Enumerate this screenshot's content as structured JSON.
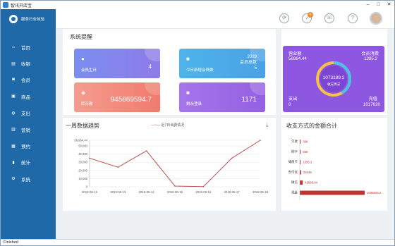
{
  "window": {
    "title": "智讯开店宝",
    "controls": [
      "–",
      "□",
      "✕"
    ]
  },
  "brand": {
    "name": "服务行业体验"
  },
  "nav": [
    {
      "label": "首页",
      "icon": "home-icon",
      "glyph": "⌂"
    },
    {
      "label": "收银",
      "icon": "cash-icon",
      "glyph": "▤"
    },
    {
      "label": "会员",
      "icon": "member-icon",
      "glyph": "◙"
    },
    {
      "label": "商品",
      "icon": "goods-icon",
      "glyph": "▣"
    },
    {
      "label": "支出",
      "icon": "expense-icon",
      "glyph": "◍"
    },
    {
      "label": "营销",
      "icon": "marketing-icon",
      "glyph": "▥"
    },
    {
      "label": "预约",
      "icon": "appointment-icon",
      "glyph": "▦"
    },
    {
      "label": "统计",
      "icon": "stats-icon",
      "glyph": "▮"
    },
    {
      "label": "系统",
      "icon": "settings-icon",
      "glyph": "⚙"
    }
  ],
  "header": {
    "notif_count": "6"
  },
  "reminders": {
    "title": "系统提醒",
    "cards": [
      {
        "label": "会员生日",
        "value": "4",
        "icon": "user-icon",
        "glyph": "👤"
      },
      {
        "label": "今日新增会员数",
        "value": "2029\n会员总数\n5",
        "icon": "chat-icon",
        "glyph": "💬"
      },
      {
        "label": "库存数",
        "value": "945869594.7",
        "icon": "box-icon",
        "glyph": "◈"
      },
      {
        "label": "剩余登录",
        "value": "1171",
        "icon": "chat-icon",
        "glyph": "💬"
      }
    ]
  },
  "kpi": {
    "revenue_label": "营业额",
    "revenue": "56964.44",
    "member_spend_label": "会员消费",
    "member_spend": "1395.2",
    "expense_label": "支出",
    "expense": "0",
    "recharge_label": "充值",
    "recharge": "1017620",
    "center_value": "1073189.2",
    "center_label": "收支情况",
    "colors": {
      "bg": "#8e57e2",
      "ring_a": "#f6c343",
      "ring_b": "#4cc3e6"
    }
  },
  "trend": {
    "title": "一周数据趋势",
    "legend": "近7日消费情况",
    "chart_data": {
      "type": "line",
      "x": [
        "2019-06-12",
        "2019-06-13",
        "2019-06-14",
        "2019-06-15",
        "2019-06-16",
        "2019-06-17",
        "2019-06-18"
      ],
      "series": [
        {
          "name": "近7日消费情况",
          "values": [
            35000,
            24000,
            44000,
            900,
            200,
            35000,
            56964.44
          ]
        }
      ],
      "y_ticks": [
        "56,964.44",
        "50,000",
        "40,000",
        "30,000",
        "20,000",
        "10,000",
        "0"
      ],
      "ylim": [
        0,
        56964.44
      ],
      "color": "#c0504d"
    }
  },
  "payment": {
    "title": "收支方式的金额合计",
    "chart_data": {
      "type": "bar",
      "categories": [
        "欠款",
        "刷卡",
        "储值卡",
        "支付宝",
        "微信",
        "现金"
      ],
      "values": [
        398,
        858,
        1395.2,
        20439,
        45068.04,
        1008826.2
      ],
      "labels": [
        "398",
        "858",
        "1395.2",
        "20439",
        "45068.04",
        "1008826.2"
      ],
      "color": "#c0342f"
    }
  },
  "status": {
    "text": "Finished"
  }
}
